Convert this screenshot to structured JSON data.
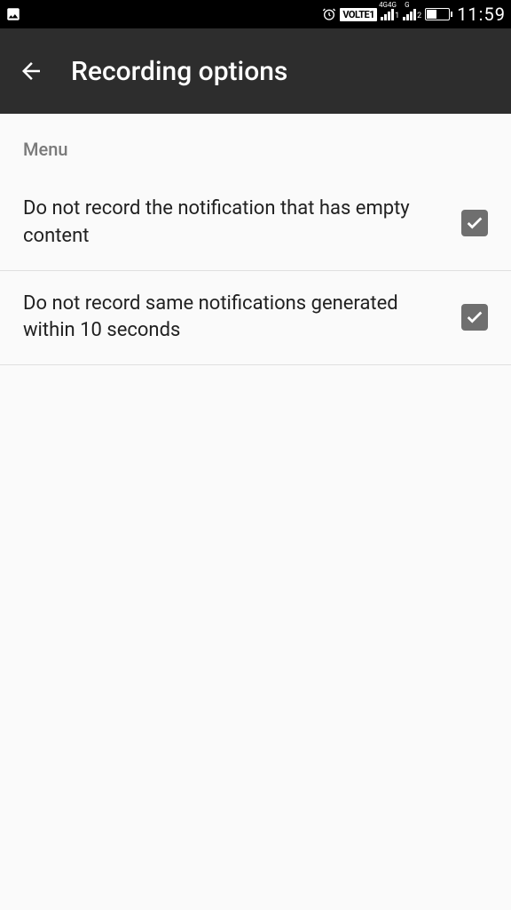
{
  "status_bar": {
    "volte": "VOLTE1",
    "network_label_1": "4G",
    "network_label_2": "4G",
    "sim1_sub": "1",
    "sim2_label": "G",
    "sim2_sub": "2",
    "time": "11:59"
  },
  "app_bar": {
    "title": "Recording options"
  },
  "section": {
    "label": "Menu"
  },
  "settings": [
    {
      "label": "Do not record the notification that has empty content",
      "checked": true
    },
    {
      "label": "Do not record same notifications generated within 10 seconds",
      "checked": true
    }
  ]
}
